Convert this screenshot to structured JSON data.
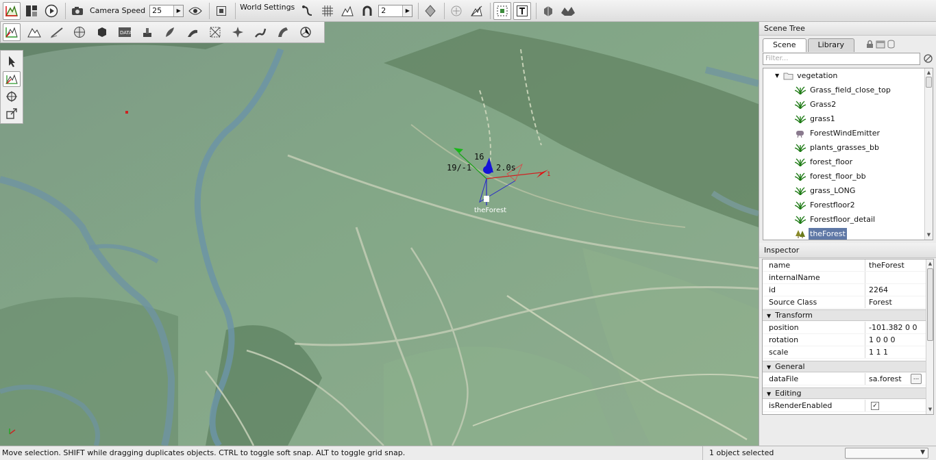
{
  "toolbar": {
    "camera_speed_label": "Camera Speed",
    "camera_speed_value": "25",
    "world_settings_label": "World Settings",
    "snap_value": "2"
  },
  "viewport": {
    "gizmo_text_a": "16",
    "gizmo_text_b": "19/-1",
    "gizmo_text_c": "2.0s",
    "gizmo_text_d": "1",
    "selected_object_label": "theForest"
  },
  "scene_tree": {
    "title": "Scene Tree",
    "tabs": [
      {
        "label": "Scene",
        "selected": true
      },
      {
        "label": "Library",
        "selected": false
      }
    ],
    "filter_placeholder": "Filter...",
    "folder": "vegetation",
    "items": [
      {
        "label": "Grass_field_close_top",
        "icon": "grass-icon"
      },
      {
        "label": "Grass2",
        "icon": "grass-icon"
      },
      {
        "label": "grass1",
        "icon": "grass-icon"
      },
      {
        "label": "ForestWindEmitter",
        "icon": "wind-emitter-icon"
      },
      {
        "label": "plants_grasses_bb",
        "icon": "grass-icon"
      },
      {
        "label": "forest_floor",
        "icon": "grass-icon"
      },
      {
        "label": "forest_floor_bb",
        "icon": "grass-icon"
      },
      {
        "label": "grass_LONG",
        "icon": "grass-icon"
      },
      {
        "label": "Forestfloor2",
        "icon": "grass-icon"
      },
      {
        "label": "Forestfloor_detail",
        "icon": "grass-icon"
      },
      {
        "label": "theForest",
        "icon": "forest-icon",
        "selected": true
      }
    ]
  },
  "inspector": {
    "title": "Inspector",
    "fields": [
      {
        "key": "name",
        "value": "theForest"
      },
      {
        "key": "internalName",
        "value": ""
      },
      {
        "key": "id",
        "value": "2264"
      },
      {
        "key": "Source Class",
        "value": "Forest"
      }
    ],
    "transform": {
      "label": "Transform",
      "fields": [
        {
          "key": "position",
          "value": "-101.382 0 0"
        },
        {
          "key": "rotation",
          "value": "1 0 0 0"
        },
        {
          "key": "scale",
          "value": "1 1 1"
        }
      ]
    },
    "general": {
      "label": "General",
      "fields": [
        {
          "key": "dataFile",
          "value": "sa.forest",
          "button": "..."
        }
      ]
    },
    "editing": {
      "label": "Editing",
      "fields": [
        {
          "key": "isRenderEnabled",
          "checked": true
        }
      ]
    }
  },
  "statusbar": {
    "message": "Move selection.  SHIFT while dragging duplicates objects.  CTRL to toggle soft snap.  ALT to toggle grid snap.",
    "selection_count": "1 object selected"
  },
  "colors": {
    "selection": "#5f78a6",
    "axis_x": "#e01010",
    "axis_y": "#10c010",
    "axis_z": "#1010e0"
  }
}
